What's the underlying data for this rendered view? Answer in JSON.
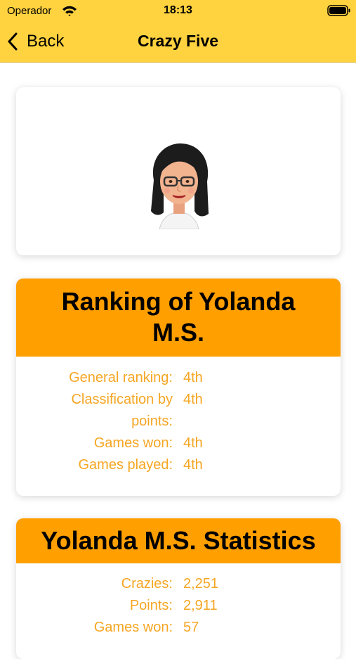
{
  "status_bar": {
    "carrier": "Operador",
    "time": "18:13",
    "wifi_icon": "wifi-icon",
    "battery_icon": "battery-icon"
  },
  "nav": {
    "back_label": "Back",
    "title": "Crazy Five"
  },
  "profile": {
    "avatar_icon": "memoji-avatar"
  },
  "ranking": {
    "title_line1": "Ranking of Yolanda",
    "title_line2": "M.S.",
    "rows": [
      {
        "label": "General ranking:",
        "value": "4th"
      },
      {
        "label_line1": "Classification by",
        "label_line2": "points:",
        "value": "4th"
      },
      {
        "label": "Games won:",
        "value": "4th"
      },
      {
        "label": "Games played:",
        "value": "4th"
      }
    ]
  },
  "statistics": {
    "title": "Yolanda M.S. Statistics",
    "rows": [
      {
        "label": "Crazies:",
        "value": "2,251"
      },
      {
        "label": "Points:",
        "value": "2,911"
      },
      {
        "label": "Games won:",
        "value": "57"
      }
    ]
  },
  "colors": {
    "nav_background": "#ffd23f",
    "header_background": "#ff9f00",
    "stat_text": "#f5a623"
  }
}
